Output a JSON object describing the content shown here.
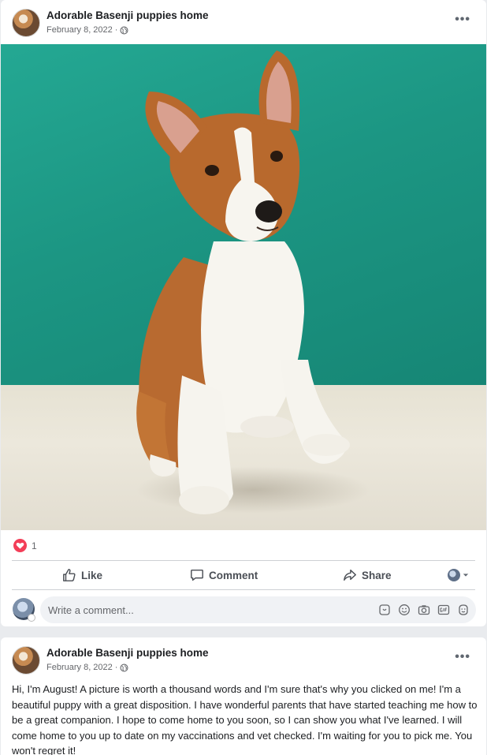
{
  "post1": {
    "page_name": "Adorable Basenji puppies home",
    "date": "February 8, 2022",
    "dot": "·",
    "more": "•••",
    "reaction_count": "1",
    "actions": {
      "like": "Like",
      "comment": "Comment",
      "share": "Share"
    },
    "comment_placeholder": "Write a comment..."
  },
  "post2": {
    "page_name": "Adorable Basenji puppies home",
    "date": "February 8, 2022",
    "dot": "·",
    "more": "•••",
    "text": "Hi, I'm August! A picture is worth a thousand words and I'm sure that's why you clicked on me! I'm a beautiful puppy with a great disposition. I have wonderful parents that have started teaching me how to be a great companion. I hope to come home to you soon, so I can show you what I've learned. I will come home to you up to date on my vaccinations and vet checked. I'm waiting for you to pick me. You won't regret it!"
  },
  "icons": {
    "globe": "globe-icon",
    "heart": "heart-icon",
    "like": "thumbs-up-icon",
    "comment": "comment-bubble-icon",
    "share": "share-arrow-icon",
    "sticker": "sticker-icon",
    "emoji": "emoji-icon",
    "camera": "camera-icon",
    "gif": "gif-icon",
    "avatar_sticker": "avatar-sticker-icon"
  },
  "colors": {
    "wall": "#1c9683",
    "floor": "#e6e2d3",
    "heart": "#f33e58",
    "secondary_text": "#65676b",
    "comment_box": "#f0f2f5"
  }
}
